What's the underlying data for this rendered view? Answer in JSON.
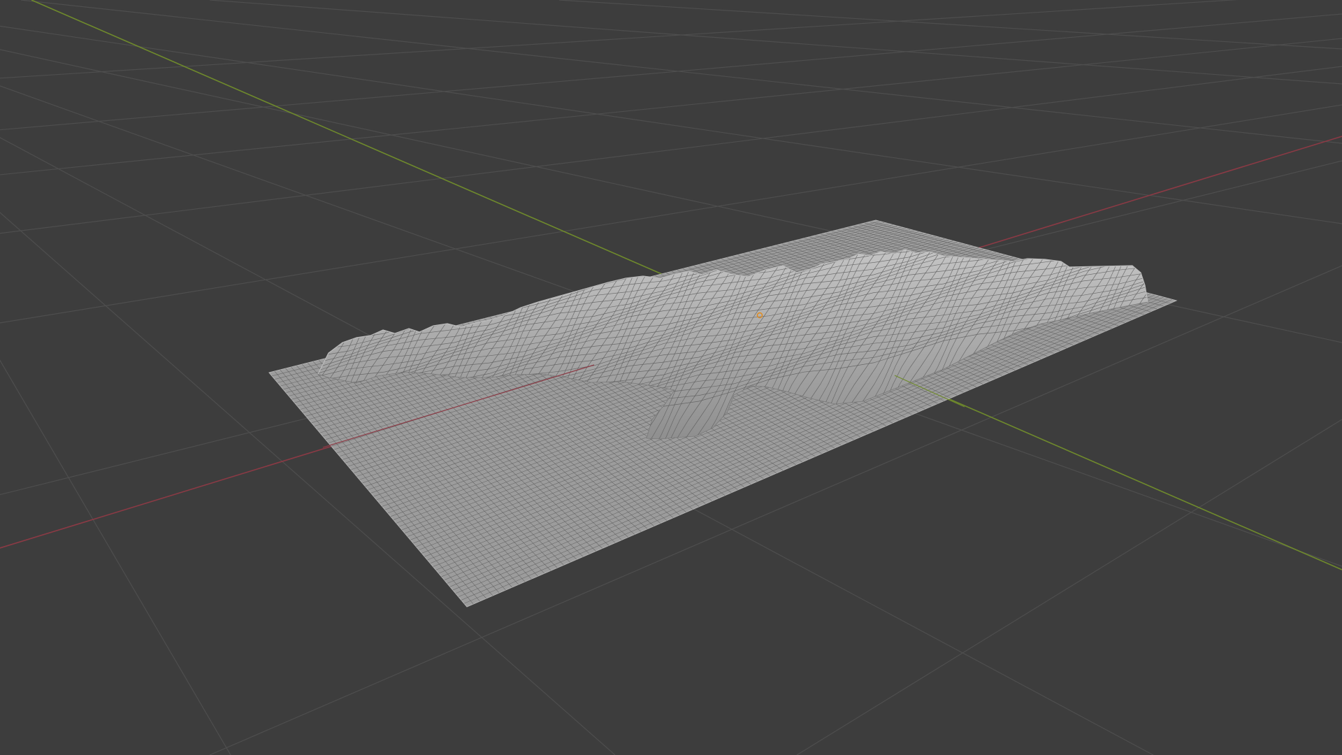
{
  "viewport": {
    "background_color": "#3d3d3d",
    "grid_color": "#4e4e4e",
    "x_axis_color": "#8b3a45",
    "y_axis_color": "#6f8a2c",
    "mesh_fill_color": "#9c9c9c",
    "mesh_wire_color": "#5a5a5a",
    "mesh_highlight_color": "#bdbdbd",
    "origin_marker_color": "#e08a1e"
  },
  "scene": {
    "object_name": "",
    "object_type": "terrain-mesh",
    "shading": "wireframe-over-solid",
    "origin_marker_icon": "origin-dot-icon"
  }
}
